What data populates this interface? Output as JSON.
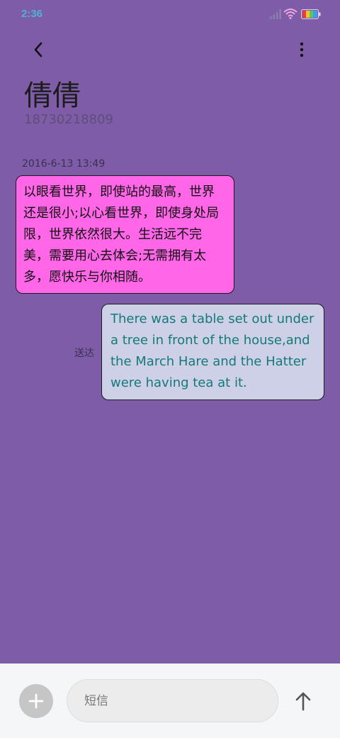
{
  "status_bar": {
    "time": "2:36",
    "icons": [
      "signal-icon",
      "wifi-icon",
      "battery-icon"
    ],
    "time_color": "#4fb2d6"
  },
  "header": {
    "back_icon": "chevron-left-icon",
    "more_icon": "more-vertical-icon",
    "contact_name": "倩倩",
    "contact_number": "18730218809"
  },
  "conversation": {
    "background": "#7e5ca8",
    "messages": [
      {
        "direction": "received",
        "timestamp": "2016-6-13 13:49",
        "text": "以眼看世界，即使站的最高，世界还是很小;以心看世界，即使身处局限，世界依然很大。生活远不完美，需要用心去体会;无需拥有太多，愿快乐与你相随。",
        "bubble_color": "#ff66e8"
      },
      {
        "direction": "sent",
        "status": "送达",
        "text": "There was a table set out under a tree in front of the house,and the March Hare and the Hatter were having tea at it.",
        "bubble_color": "#cdd0e6",
        "text_color": "#147a78"
      }
    ]
  },
  "compose": {
    "add_icon": "plus-icon",
    "placeholder": "短信",
    "value": "",
    "send_icon": "arrow-up-icon"
  }
}
